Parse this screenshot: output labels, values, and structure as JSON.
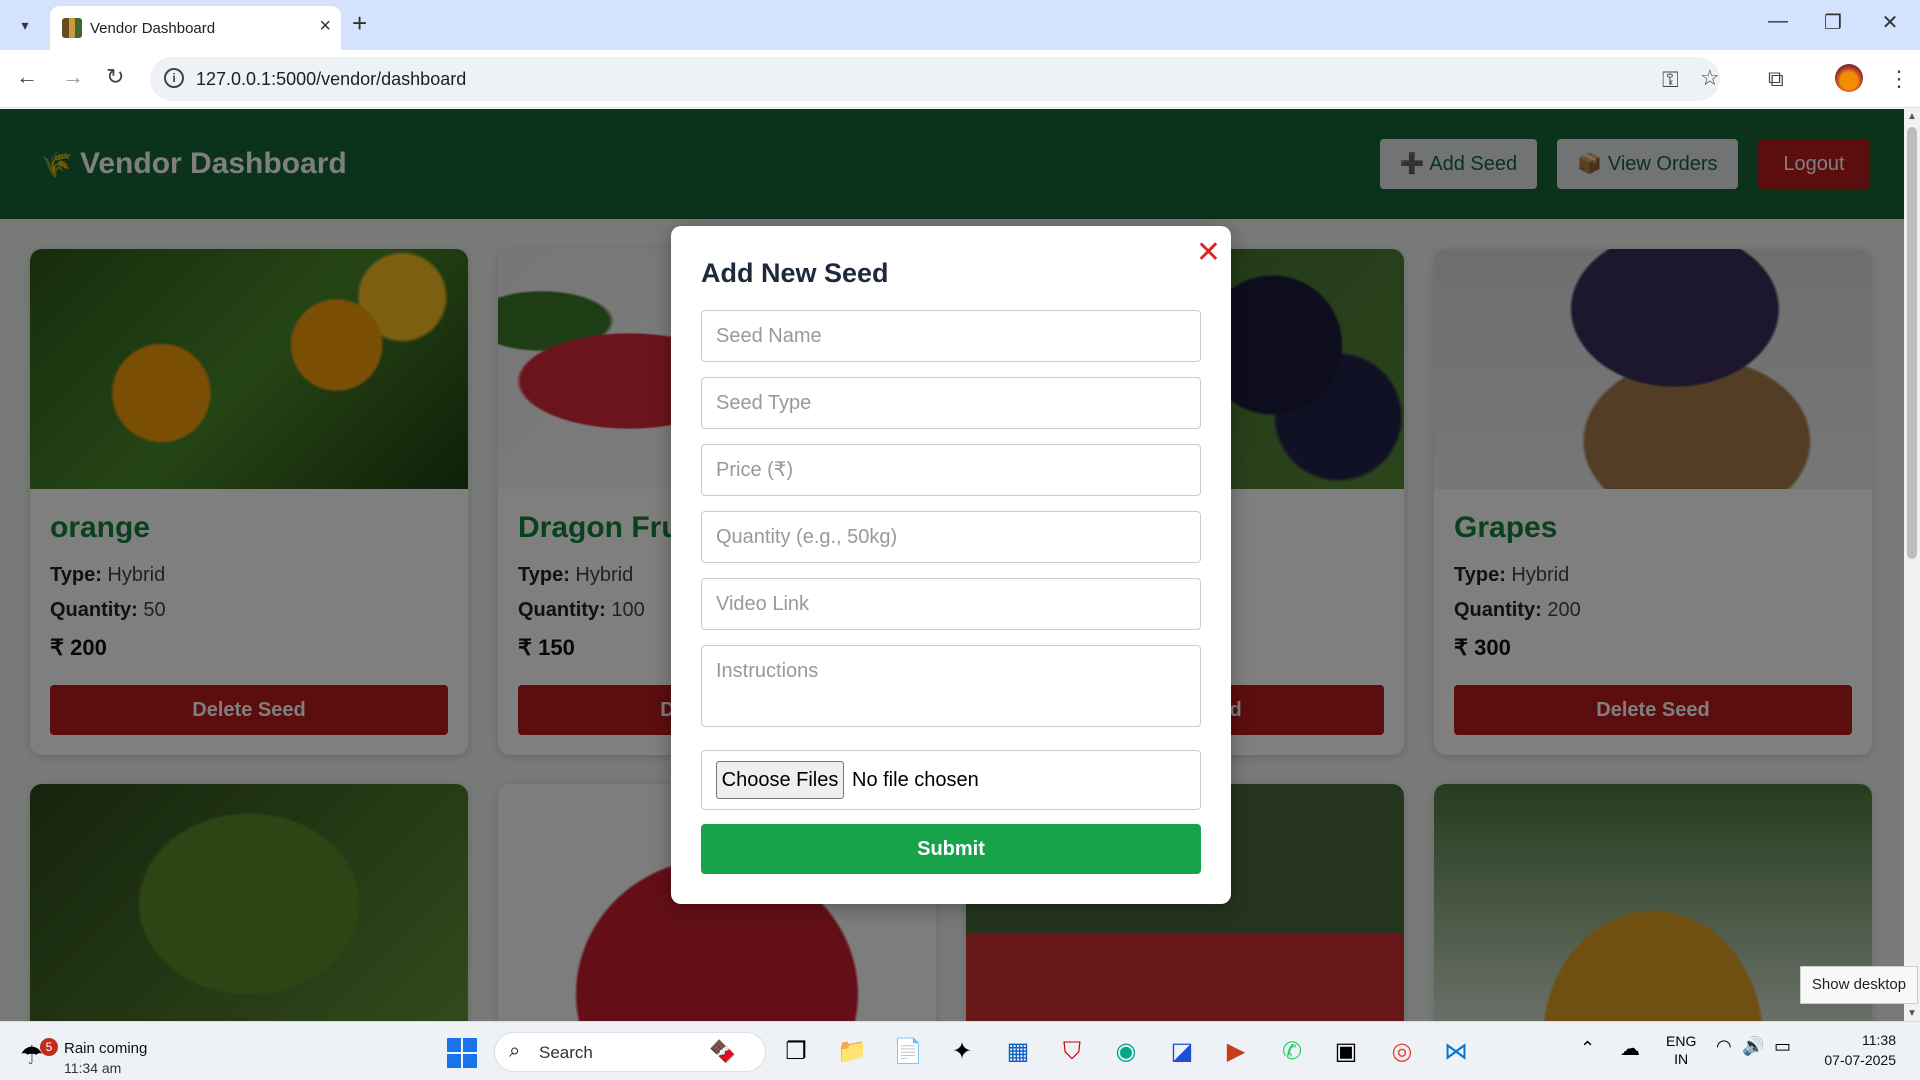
{
  "browser": {
    "tab_title": "Vendor Dashboard",
    "url": "127.0.0.1:5000/vendor/dashboard"
  },
  "header": {
    "logo_icon": "🌾",
    "title": "Vendor Dashboard",
    "add_seed": "➕ Add Seed",
    "view_orders": "📦 View Orders",
    "logout": "Logout",
    "color": "#166534"
  },
  "cards": [
    {
      "name": "orange",
      "type_label": "Type:",
      "type": "Hybrid",
      "qty_label": "Quantity:",
      "qty": "50",
      "price": "₹ 200",
      "delete": "Delete Seed"
    },
    {
      "name": "Dragon Fru",
      "type_label": "Type:",
      "type": "Hybrid",
      "qty_label": "Quantity:",
      "qty": "100",
      "price": "₹ 150",
      "delete": "Delete Seed"
    },
    {
      "name": "",
      "type_label": "",
      "type": "",
      "qty_label": "",
      "qty": "",
      "price": "",
      "delete": "Delete Seed"
    },
    {
      "name": "Grapes",
      "type_label": "Type:",
      "type": "Hybrid",
      "qty_label": "Quantity:",
      "qty": "200",
      "price": "₹ 300",
      "delete": "Delete Seed"
    }
  ],
  "modal": {
    "title": "Add New Seed",
    "close": "✕",
    "placeholders": {
      "seed_name": "Seed Name",
      "seed_type": "Seed Type",
      "price": "Price (₹)",
      "quantity": "Quantity (e.g., 50kg)",
      "video": "Video Link",
      "instructions": "Instructions"
    },
    "choose_files": "Choose Files",
    "no_file": "No file chosen",
    "submit": "Submit"
  },
  "tooltip": "Show desktop",
  "taskbar": {
    "weather_badge": "5",
    "weather_line1": "Rain coming",
    "weather_line2": "11:34 am",
    "search": "Search",
    "lang1": "ENG",
    "lang2": "IN",
    "time": "11:38",
    "date": "07-07-2025"
  }
}
